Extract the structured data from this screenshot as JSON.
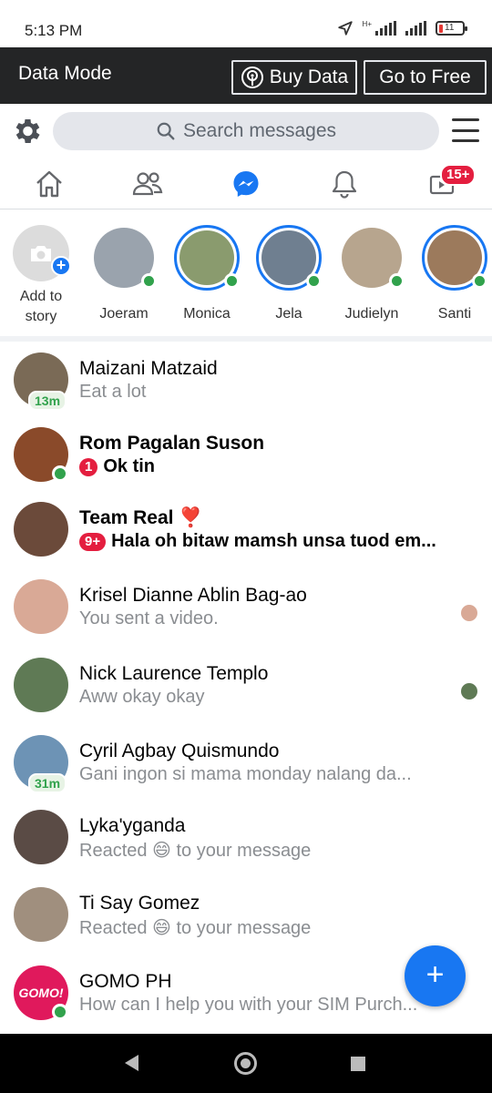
{
  "status_bar": {
    "time": "5:13 PM",
    "network": "H+",
    "battery": "11"
  },
  "data_mode": {
    "title": "Data Mode",
    "buy_label": "Buy Data",
    "free_label": "Go to Free"
  },
  "search": {
    "placeholder": "Search messages"
  },
  "tabs": {
    "notifications_badge": "15+"
  },
  "stories": [
    {
      "name": "Add to story",
      "line1": "Add to",
      "line2": "story",
      "type": "add"
    },
    {
      "name": "Joeram",
      "online": true,
      "color": "#9aa3ad"
    },
    {
      "name": "Monica",
      "online": true,
      "color": "#8a9b6e"
    },
    {
      "name": "Jela",
      "online": true,
      "color": "#6f7f90"
    },
    {
      "name": "Judielyn",
      "online": true,
      "color": "#b7a58e"
    },
    {
      "name": "Santi",
      "online": true,
      "color": "#9c7a5c"
    }
  ],
  "chats": [
    {
      "name": "Maizani Matzaid",
      "message": "Eat a lot",
      "active_time": "13m",
      "bold": false,
      "color": "#7a6a56"
    },
    {
      "name": "Rom Pagalan Suson",
      "message": "Ok tin",
      "unread": "1",
      "online": true,
      "bold": true,
      "color": "#8a4a2a"
    },
    {
      "name": "Team Real ❣️",
      "message": "Hala oh bitaw mamsh unsa tuod em...",
      "unread": "9+",
      "bold": true,
      "color": "#6b4a3a"
    },
    {
      "name": "Krisel Dianne Ablin Bag-ao",
      "message": "You sent a video.",
      "bold": false,
      "seen": true,
      "color": "#d9a996"
    },
    {
      "name": "Nick Laurence Templo",
      "message": "Aww okay okay",
      "bold": false,
      "seen": true,
      "color": "#5f7a55"
    },
    {
      "name": "Cyril Agbay Quismundo",
      "message": "Gani ingon si mama monday nalang da...",
      "active_time": "31m",
      "bold": false,
      "color": "#6d93b5"
    },
    {
      "name": "Lyka'yganda",
      "message": "Reacted 😄 to your message",
      "bold": false,
      "color": "#5a4b45"
    },
    {
      "name": "Ti Say Gomez",
      "message": "Reacted 😄 to your message",
      "bold": false,
      "color": "#a08f7e"
    },
    {
      "name": "GOMO PH",
      "message": "How can I help you with your SIM Purch...",
      "online": true,
      "bold": false,
      "color": "#e0195c",
      "logo_text": "GOMO!"
    }
  ],
  "fab": {
    "icon": "plus-icon"
  },
  "colors": {
    "accent": "#1877f2",
    "online": "#31a24c",
    "badge": "#e41e3f",
    "header": "#242526"
  }
}
